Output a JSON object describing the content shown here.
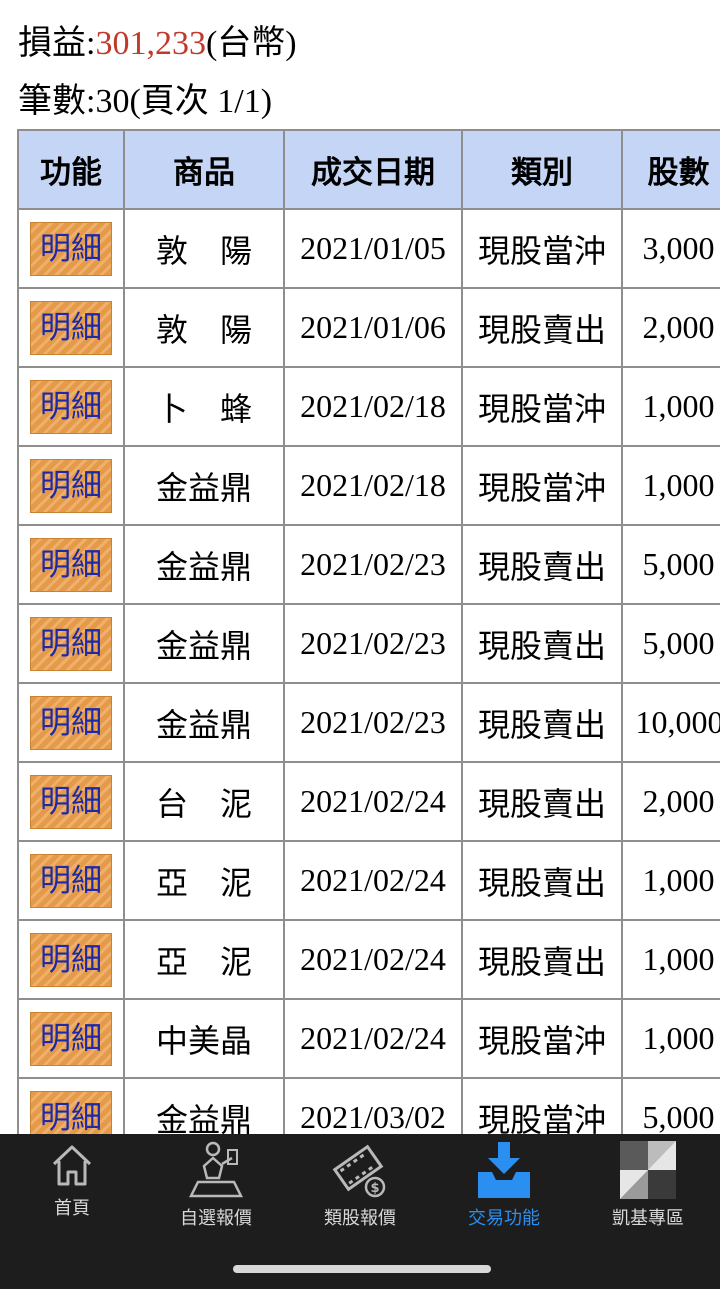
{
  "summary": {
    "pnl_label": "損益:",
    "pnl_value": "301,233",
    "pnl_unit": "(台幣)",
    "count_text": "筆數:30(頁次 1/1)"
  },
  "table": {
    "headers": [
      "功能",
      "商品",
      "成交日期",
      "類別",
      "股數"
    ],
    "detail_label": "明細",
    "rows": [
      {
        "product": "敦　陽",
        "date": "2021/01/05",
        "type": "現股當沖",
        "shares": "3,000"
      },
      {
        "product": "敦　陽",
        "date": "2021/01/06",
        "type": "現股賣出",
        "shares": "2,000"
      },
      {
        "product": "卜　蜂",
        "date": "2021/02/18",
        "type": "現股當沖",
        "shares": "1,000"
      },
      {
        "product": "金益鼎",
        "date": "2021/02/18",
        "type": "現股當沖",
        "shares": "1,000"
      },
      {
        "product": "金益鼎",
        "date": "2021/02/23",
        "type": "現股賣出",
        "shares": "5,000"
      },
      {
        "product": "金益鼎",
        "date": "2021/02/23",
        "type": "現股賣出",
        "shares": "5,000"
      },
      {
        "product": "金益鼎",
        "date": "2021/02/23",
        "type": "現股賣出",
        "shares": "10,000"
      },
      {
        "product": "台　泥",
        "date": "2021/02/24",
        "type": "現股賣出",
        "shares": "2,000"
      },
      {
        "product": "亞　泥",
        "date": "2021/02/24",
        "type": "現股賣出",
        "shares": "1,000"
      },
      {
        "product": "亞　泥",
        "date": "2021/02/24",
        "type": "現股賣出",
        "shares": "1,000"
      },
      {
        "product": "中美晶",
        "date": "2021/02/24",
        "type": "現股當沖",
        "shares": "1,000"
      },
      {
        "product": "金益鼎",
        "date": "2021/03/02",
        "type": "現股當沖",
        "shares": "5,000"
      }
    ]
  },
  "tabbar": {
    "tabs": [
      {
        "label": "首頁",
        "icon": "home-icon"
      },
      {
        "label": "自選報價",
        "icon": "trader-icon"
      },
      {
        "label": "類股報價",
        "icon": "film-coin-icon"
      },
      {
        "label": "交易功能",
        "icon": "tray-download-icon"
      },
      {
        "label": "凱基專區",
        "icon": "kgi-logo-icon"
      }
    ],
    "active_index": 3,
    "active_color": "#2a8ff0"
  }
}
